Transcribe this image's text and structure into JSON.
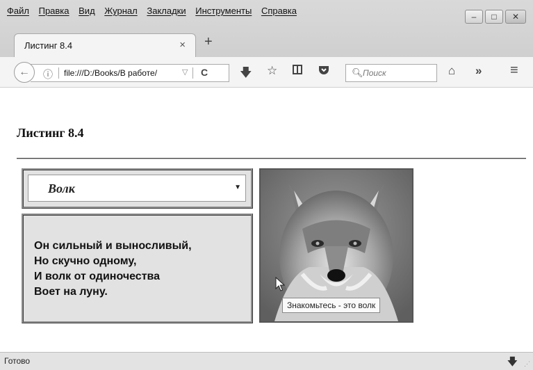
{
  "menubar": {
    "items": [
      "Файл",
      "Правка",
      "Вид",
      "Журнал",
      "Закладки",
      "Инструменты",
      "Справка"
    ]
  },
  "window_controls": {
    "minimize": "–",
    "maximize": "□",
    "close": "✕"
  },
  "tab": {
    "title": "Листинг 8.4",
    "close": "×",
    "new_tab": "+"
  },
  "navbar": {
    "url": "file:///D:/Books/В работе/",
    "search_placeholder": "Поиск"
  },
  "page": {
    "heading": "Листинг 8.4",
    "select": {
      "selected": "Волк"
    },
    "poem": [
      "Он сильный и выносливый,",
      "Но скучно одному,",
      "И волк от одиночества",
      "Воет на луну."
    ],
    "image_tooltip": "Знакомьтесь - это волк"
  },
  "status": {
    "text": "Готово"
  }
}
